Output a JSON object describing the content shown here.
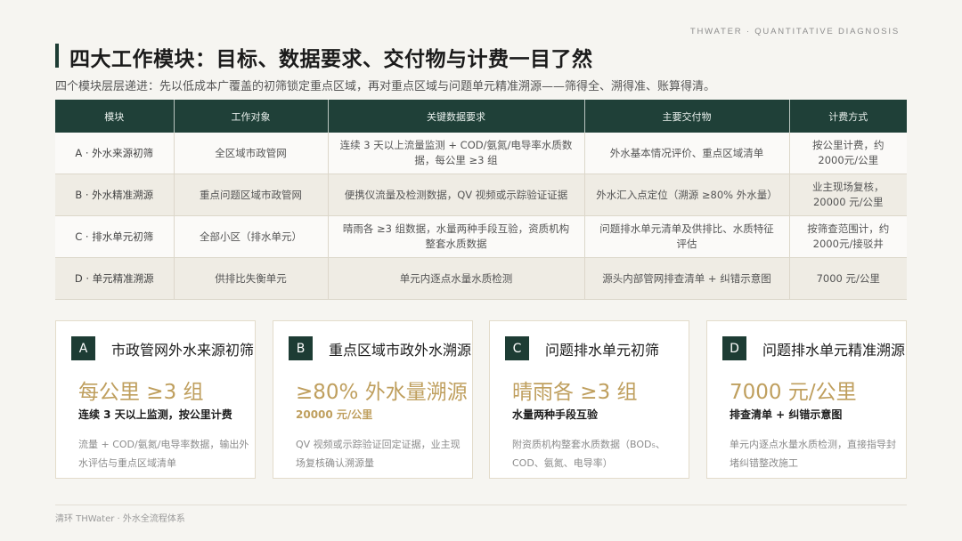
{
  "header": {
    "brand": "THWATER · QUANTITATIVE DIAGNOSIS"
  },
  "title": "四大工作模块：目标、数据要求、交付物与计费一目了然",
  "subtitle": "四个模块层层递进：先以低成本广覆盖的初筛锁定重点区域，再对重点区域与问题单元精准溯源——筛得全、溯得准、账算得清。",
  "table": {
    "headers": [
      "模块",
      "工作对象",
      "关键数据要求",
      "主要交付物",
      "计费方式"
    ],
    "rows": [
      [
        "A · 外水来源初筛",
        "全区域市政管网",
        "连续 3 天以上流量监测 + COD/氨氮/电导率水质数据，每公里 ≥3 组",
        "外水基本情况评价、重点区域清单",
        "按公里计费，约2000元/公里"
      ],
      [
        "B · 外水精准溯源",
        "重点问题区域市政管网",
        "便携仪流量及检测数据，QV 视频或示踪验证证据",
        "外水汇入点定位（溯源 ≥80% 外水量）",
        "业主现场复核，20000 元/公里"
      ],
      [
        "C · 排水单元初筛",
        "全部小区（排水单元）",
        "晴雨各 ≥3 组数据，水量两种手段互验，资质机构整套水质数据",
        "问题排水单元清单及供排比、水质特征评估",
        "按筛查范围计，约2000元/接驳井"
      ],
      [
        "D · 单元精准溯源",
        "供排比失衡单元",
        "单元内逐点水量水质检测",
        "源头内部管网排查清单 + 纠错示意图",
        "7000 元/公里"
      ]
    ]
  },
  "cards": [
    {
      "letter": "A",
      "title": "市政管网外水来源初筛",
      "metric": "每公里 ≥3 组",
      "metric_sub": "连续 3 天以上监测，按公里计费",
      "note": "流量 + COD/氨氮/电导率数据，输出外水评估与重点区域清单"
    },
    {
      "letter": "B",
      "title": "重点区域市政外水溯源",
      "metric": "≥80% 外水量溯源",
      "metric_sub": "20000 元/公里",
      "note": "QV 视频或示踪验证回定证据，业主现场复核确认溯源量"
    },
    {
      "letter": "C",
      "title": "问题排水单元初筛",
      "metric": "晴雨各 ≥3 组",
      "metric_sub": "水量两种手段互验",
      "note": "附资质机构整套水质数据（BOD₅、COD、氨氮、电导率）"
    },
    {
      "letter": "D",
      "title": "问题排水单元精准溯源",
      "metric": "7000 元/公里",
      "metric_sub": "排查清单 + 纠错示意图",
      "note": "单元内逐点水量水质检测，直接指导封堵纠错整改施工"
    }
  ],
  "footer": "清环 THWater · 外水全流程体系"
}
